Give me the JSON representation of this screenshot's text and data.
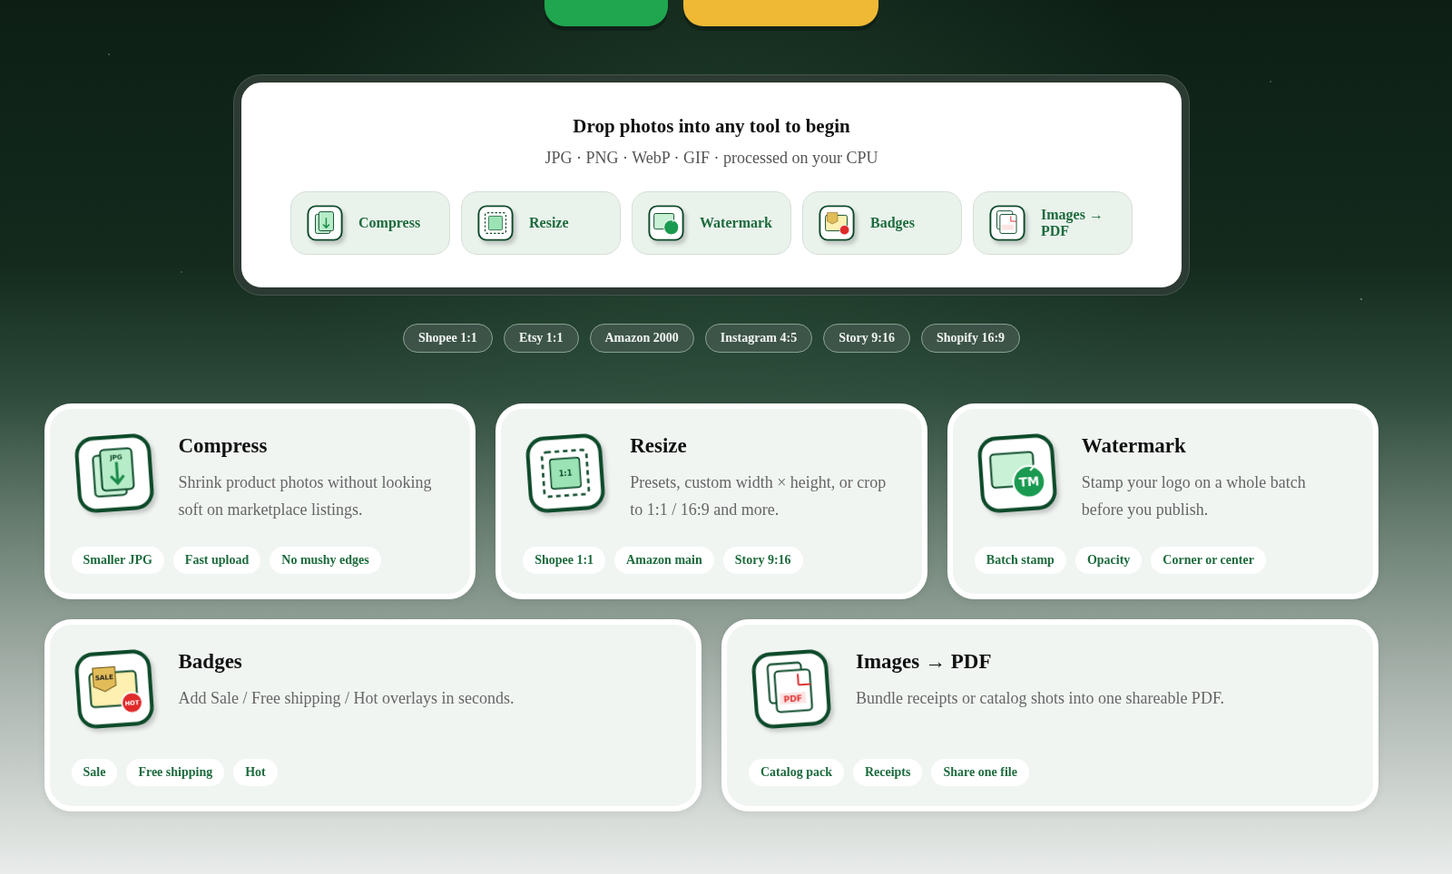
{
  "top_buttons": [
    {
      "color": "#1fa64f"
    },
    {
      "color": "#efb935"
    }
  ],
  "dropzone": {
    "title": "Drop photos into any tool to begin",
    "subtitle": "JPG · PNG · WebP · GIF · processed on your CPU",
    "tools": [
      {
        "kind": "compress",
        "label": "Compress"
      },
      {
        "kind": "resize",
        "label": "Resize"
      },
      {
        "kind": "watermark",
        "label": "Watermark"
      },
      {
        "kind": "badges",
        "label": "Badges"
      },
      {
        "kind": "pdf",
        "label": "Images → PDF"
      }
    ]
  },
  "presets": [
    "Shopee 1:1",
    "Etsy 1:1",
    "Amazon 2000",
    "Instagram 4:5",
    "Story 9:16",
    "Shopify 16:9"
  ],
  "cards": [
    {
      "kind": "compress",
      "title": "Compress",
      "icon_text": [
        "JPG"
      ],
      "description": "Shrink product photos without looking soft on marketplace listings.",
      "tags": [
        "Smaller JPG",
        "Fast upload",
        "No mushy edges"
      ]
    },
    {
      "kind": "resize",
      "title": "Resize",
      "icon_text": [
        "1:1"
      ],
      "description": "Presets, custom width × height, or crop to 1:1 / 16:9 and more.",
      "tags": [
        "Shopee 1:1",
        "Amazon main",
        "Story 9:16"
      ]
    },
    {
      "kind": "watermark",
      "title": "Watermark",
      "icon_text": [
        "TM"
      ],
      "description": "Stamp your logo on a whole batch before you publish.",
      "tags": [
        "Batch stamp",
        "Opacity",
        "Corner or center"
      ]
    },
    {
      "kind": "badges",
      "title": "Badges",
      "icon_text": [
        "SALE",
        "HOT"
      ],
      "description": "Add Sale / Free shipping / Hot overlays in seconds.",
      "tags": [
        "Sale",
        "Free shipping",
        "Hot"
      ]
    },
    {
      "kind": "pdf",
      "title": "Images → PDF",
      "icon_text": [
        "PDF"
      ],
      "description": "Bundle receipts or catalog shots into one shareable PDF.",
      "tags": [
        "Catalog pack",
        "Receipts",
        "Share one file"
      ]
    }
  ]
}
